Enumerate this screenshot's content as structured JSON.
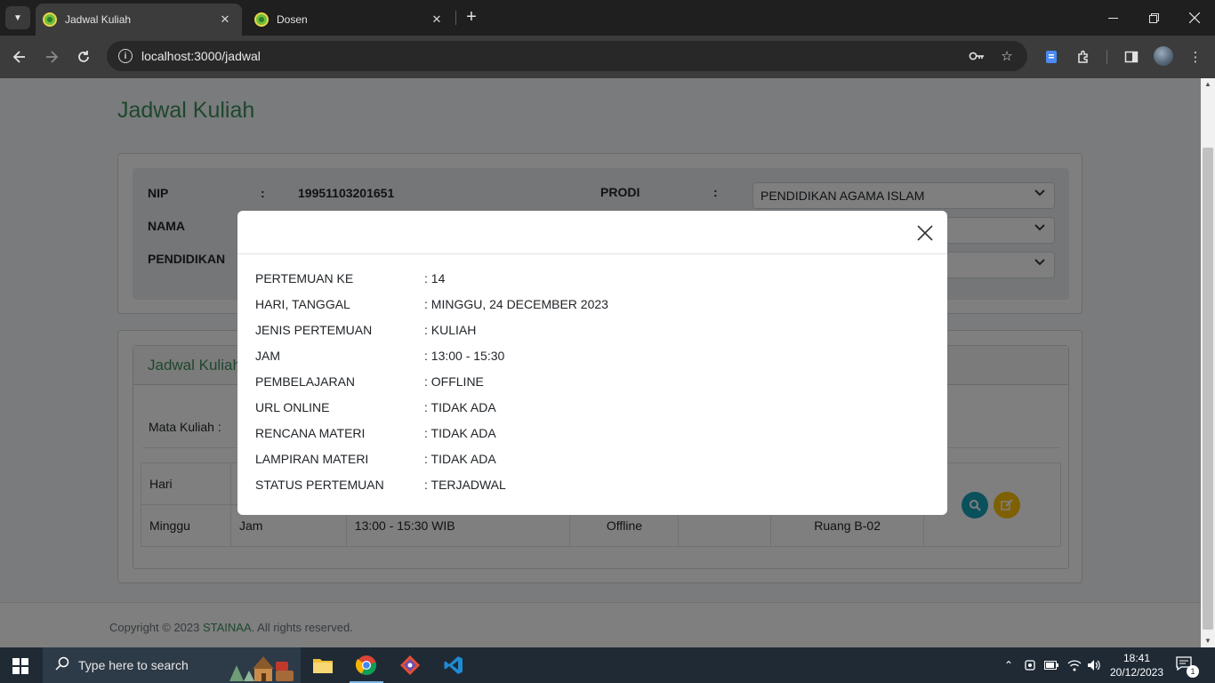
{
  "browser": {
    "tabs": [
      {
        "title": "Jadwal Kuliah",
        "active": true
      },
      {
        "title": "Dosen",
        "active": false
      }
    ],
    "new_tab_symbol": "+",
    "url": "localhost:3000/jadwal"
  },
  "page": {
    "title": "Jadwal Kuliah",
    "lecturer": {
      "nip_label": "NIP",
      "nip_value": "19951103201651",
      "nama_label": "NAMA",
      "pendidikan_label": "PENDIDIKAN",
      "colon": ":",
      "prodi_label": "PRODI",
      "prodi_value": "PENDIDIKAN AGAMA ISLAM"
    },
    "schedule_card": {
      "header": "Jadwal Kuliah",
      "mata_kuliah_label": "Mata Kuliah :",
      "table": {
        "header_cell": "Hari",
        "row": {
          "hari": "Minggu",
          "jam_label": "Jam",
          "jam_value": "13:00 - 15:30 WIB",
          "mode": "Offline",
          "ruang": "Ruang B-02"
        }
      }
    },
    "footer": {
      "prefix": "Copyright © 2023 ",
      "brand": "STAINAA",
      "suffix": ". All rights reserved."
    }
  },
  "modal": {
    "rows": [
      {
        "key": "PERTEMUAN KE",
        "value": ": 14"
      },
      {
        "key": "HARI, TANGGAL",
        "value": ": MINGGU, 24 DECEMBER 2023"
      },
      {
        "key": "JENIS PERTEMUAN",
        "value": ": KULIAH"
      },
      {
        "key": "JAM",
        "value": ": 13:00 - 15:30"
      },
      {
        "key": "PEMBELAJARAN",
        "value": ": OFFLINE"
      },
      {
        "key": "URL ONLINE",
        "value": ": TIDAK ADA"
      },
      {
        "key": "RENCANA MATERI",
        "value": ": TIDAK ADA"
      },
      {
        "key": "LAMPIRAN MATERI",
        "value": ": TIDAK ADA"
      },
      {
        "key": "STATUS PERTEMUAN",
        "value": ": TERJADWAL"
      }
    ]
  },
  "taskbar": {
    "search_placeholder": "Type here to search",
    "time": "18:41",
    "date": "20/12/2023",
    "notification_count": "1"
  },
  "colors": {
    "accent_green": "#3d8f5c",
    "info_button": "#17a2b8",
    "edit_button": "#ffc107"
  },
  "icons": {
    "tab_search": "chevron-down-icon",
    "close": "close-icon",
    "back": "back-arrow-icon",
    "forward": "forward-arrow-icon",
    "reload": "reload-icon",
    "key": "key-icon",
    "star": "star-icon",
    "extensions": "puzzle-icon",
    "view": "search-icon",
    "edit": "edit-icon"
  }
}
